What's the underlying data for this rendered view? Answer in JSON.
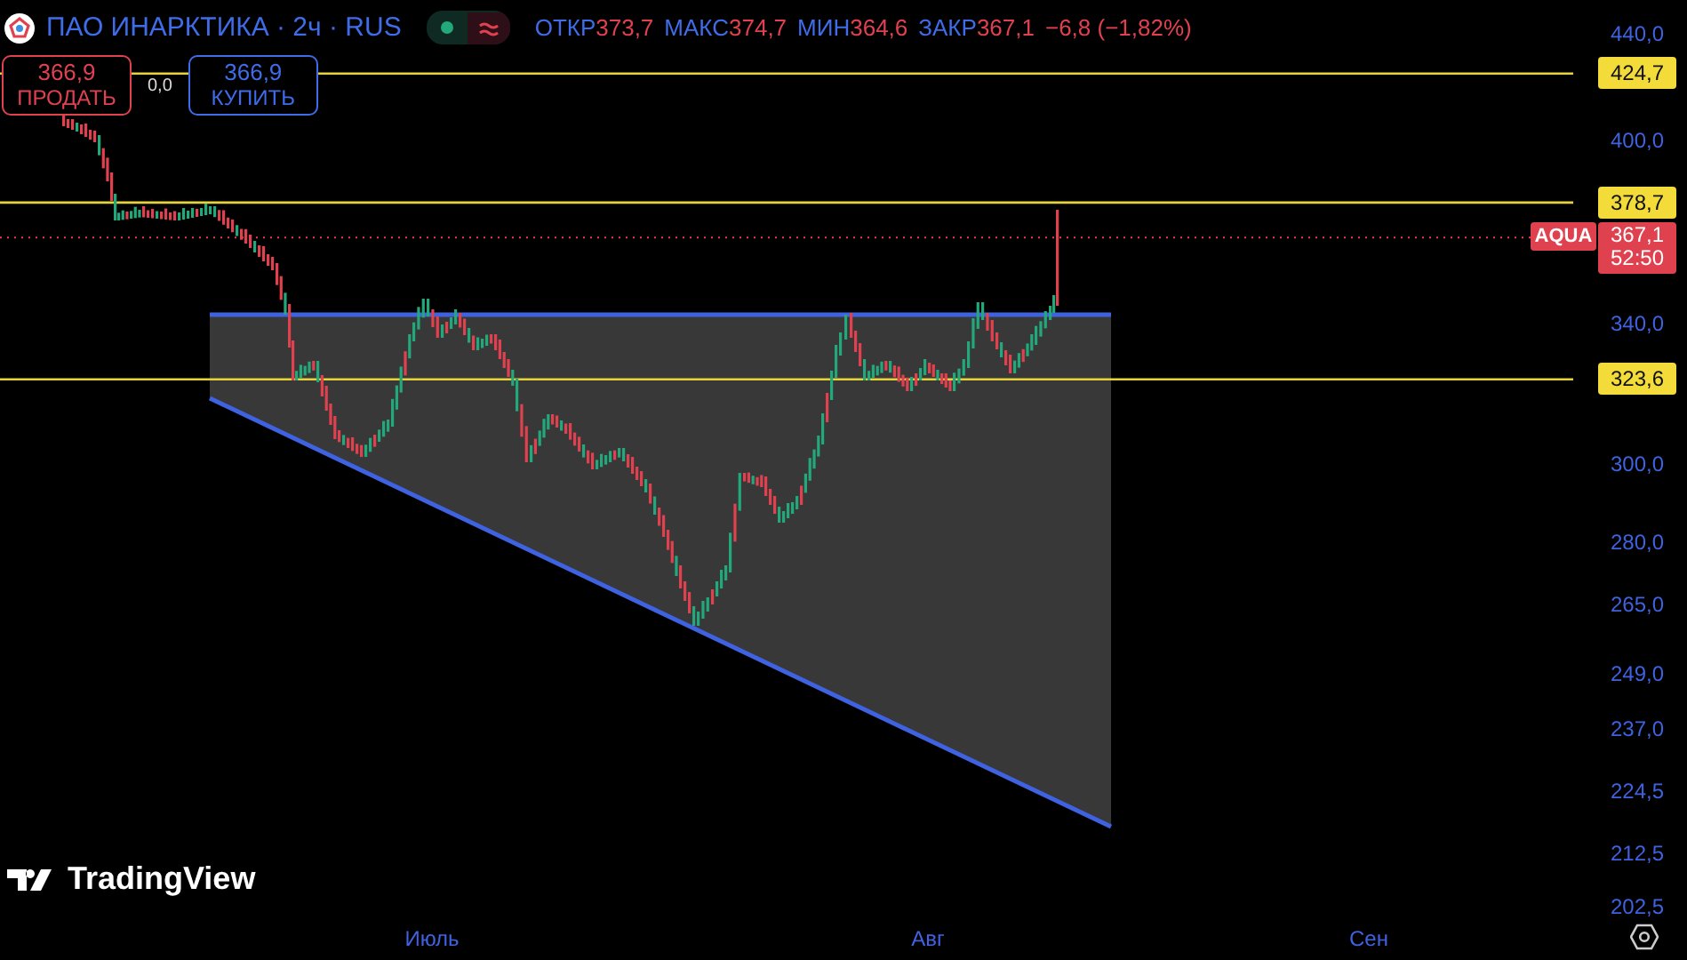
{
  "header": {
    "title": "ПАО ИНАРКТИКА · 2ч · RUS",
    "ohlc": [
      {
        "label": "ОТКР",
        "value": "373,7"
      },
      {
        "label": "МАКС",
        "value": "374,7"
      },
      {
        "label": "МИН",
        "value": "364,6"
      },
      {
        "label": "ЗАКР",
        "value": "367,1"
      }
    ],
    "change": "−6,8 (−1,82%)"
  },
  "trade": {
    "sell": {
      "price": "366,9",
      "label": "ПРОДАТЬ"
    },
    "spread": "0,0",
    "buy": {
      "price": "366,9",
      "label": "КУПИТЬ"
    }
  },
  "price_axis": {
    "ticks": [
      "440,0",
      "400,0",
      "340,0",
      "300,0",
      "280,0",
      "265,0",
      "249,0",
      "237,0",
      "224,5",
      "212,5",
      "202,5"
    ]
  },
  "levels": [
    {
      "value": "424,7"
    },
    {
      "value": "378,7"
    },
    {
      "value": "323,6"
    }
  ],
  "current_price": {
    "symbol": "AQUA",
    "price": "367,1",
    "countdown": "52:50"
  },
  "time_axis": {
    "labels": [
      "Июль",
      "Авг",
      "Сен"
    ]
  },
  "brand": "TradingView"
}
